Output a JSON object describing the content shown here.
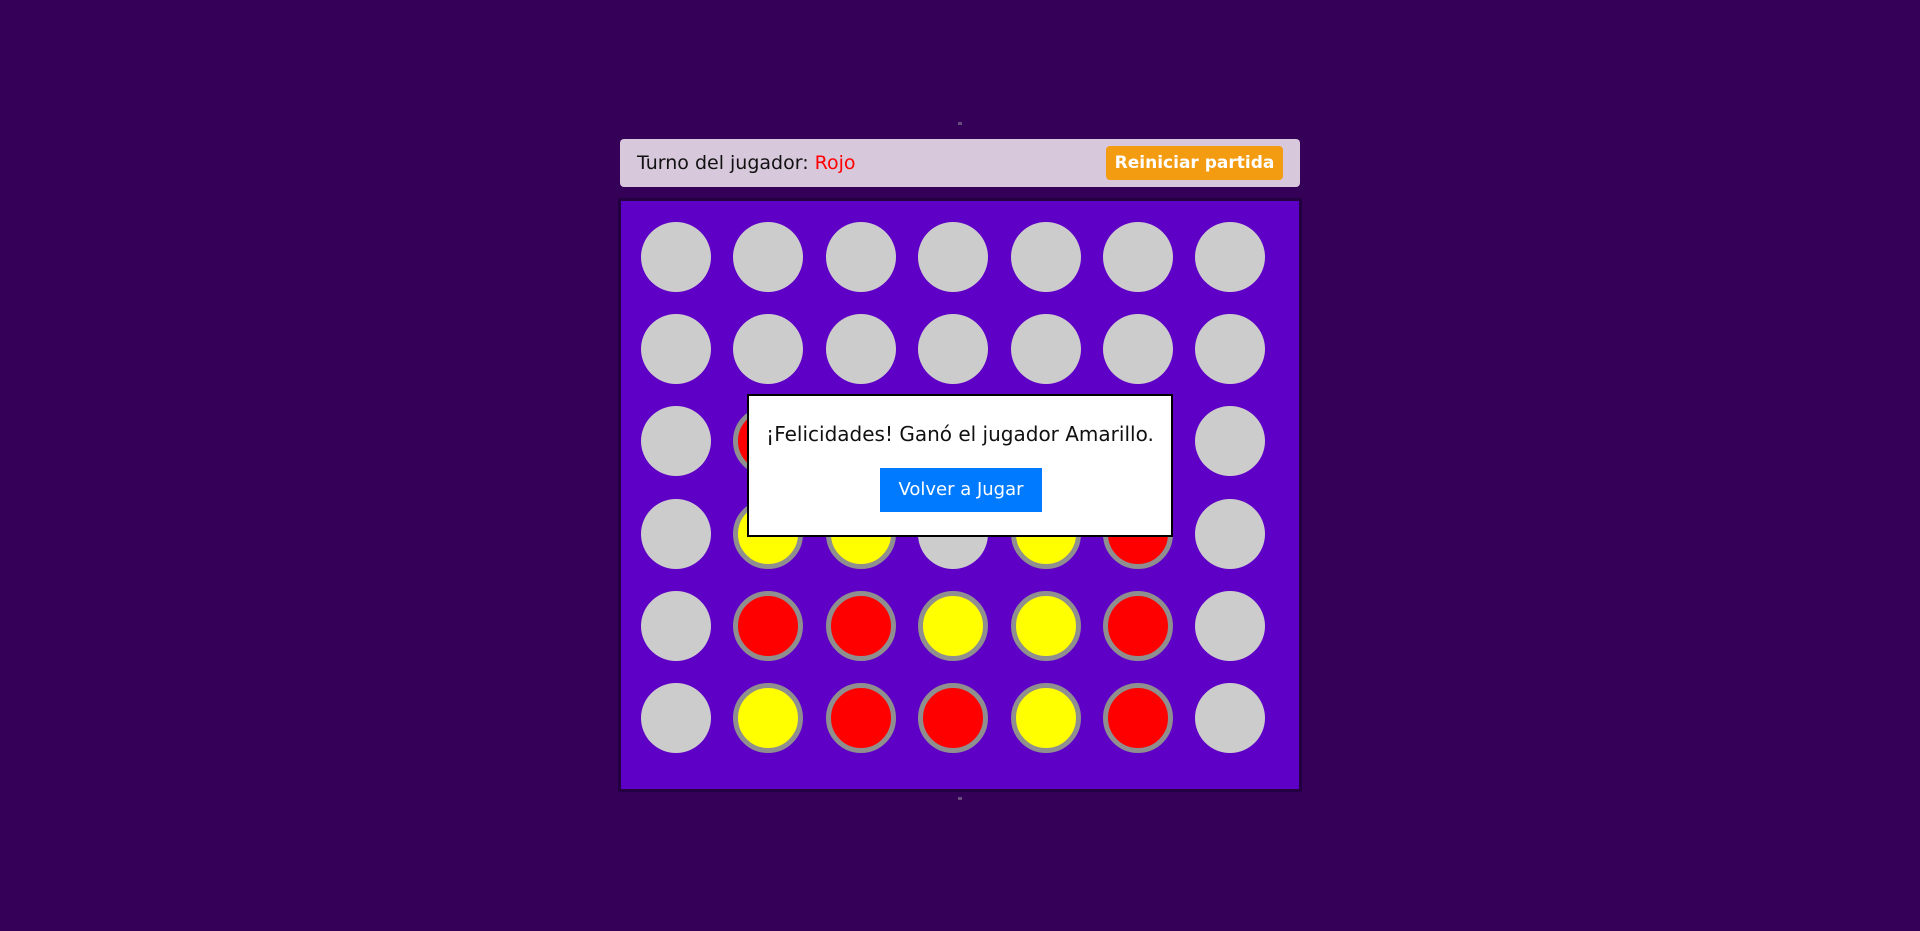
{
  "status": {
    "turn_label": "Turno del jugador:",
    "current_player": "Rojo",
    "current_player_color": "#ff0000",
    "restart_label": "Reiniciar partida"
  },
  "board": {
    "columns": 7,
    "rows": 6,
    "cells": [
      [
        "empty",
        "empty",
        "empty",
        "empty",
        "empty",
        "empty",
        "empty"
      ],
      [
        "empty",
        "empty",
        "empty",
        "empty",
        "empty",
        "empty",
        "empty"
      ],
      [
        "empty",
        "red",
        "red",
        "red",
        "yellow",
        "yellow",
        "empty"
      ],
      [
        "empty",
        "yellow",
        "yellow",
        "empty",
        "yellow",
        "red",
        "empty"
      ],
      [
        "empty",
        "red",
        "red",
        "yellow",
        "yellow",
        "red",
        "empty"
      ],
      [
        "empty",
        "yellow",
        "red",
        "red",
        "yellow",
        "red",
        "empty"
      ]
    ],
    "colors": {
      "board": "#5e00c6",
      "empty": "#cccccc",
      "red": "#ff0000",
      "yellow": "#ffff00"
    }
  },
  "modal": {
    "message": "¡Felicidades! Ganó el jugador Amarillo.",
    "button_label": "Volver a Jugar"
  },
  "colors": {
    "background": "#350058",
    "accent_button": "#f39c12",
    "primary_button": "#007bff"
  }
}
